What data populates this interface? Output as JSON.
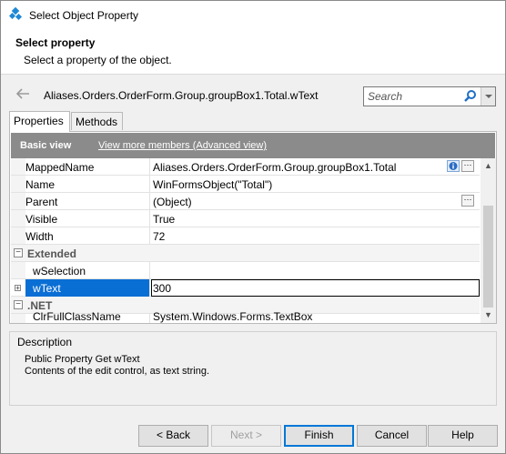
{
  "window": {
    "title": "Select Object Property"
  },
  "header": {
    "title": "Select property",
    "subtitle": "Select a property of the object."
  },
  "object_path": "Aliases.Orders.OrderForm.Group.groupBox1.Total.wText",
  "search": {
    "placeholder": "Search"
  },
  "tabs": [
    {
      "label": "Properties"
    },
    {
      "label": "Methods"
    }
  ],
  "panel": {
    "basic_label": "Basic view",
    "advanced_link": "View more members (Advanced view)"
  },
  "rows": [
    {
      "name": "MappedName",
      "value": "Aliases.Orders.OrderForm.Group.groupBox1.Total"
    },
    {
      "name": "Name",
      "value": "WinFormsObject(\"Total\")"
    },
    {
      "name": "Parent",
      "value": "(Object)"
    },
    {
      "name": "Visible",
      "value": "True"
    },
    {
      "name": "Width",
      "value": "72"
    }
  ],
  "groups": {
    "extended": "Extended",
    "net": ".NET"
  },
  "extended_rows": [
    {
      "name": "wSelection",
      "value": ""
    },
    {
      "name": "wText",
      "value": "300"
    }
  ],
  "net_rows": [
    {
      "name": "ClrFullClassName",
      "value": "System.Windows.Forms.TextBox"
    }
  ],
  "description": {
    "title": "Description",
    "line1": "Public Property Get wText",
    "line2": "Contents of the edit control, as text string."
  },
  "buttons": {
    "back": "< Back",
    "next": "Next >",
    "finish": "Finish",
    "cancel": "Cancel",
    "help": "Help"
  },
  "colors": {
    "selection": "#0a6fd4",
    "accent": "#0078d7",
    "bar": "#8b8b8b"
  },
  "icons": [
    "app-icon",
    "back-arrow-icon",
    "search-icon",
    "dropdown-icon",
    "info-icon",
    "ellipsis-icon",
    "collapse-icon",
    "expand-icon"
  ]
}
